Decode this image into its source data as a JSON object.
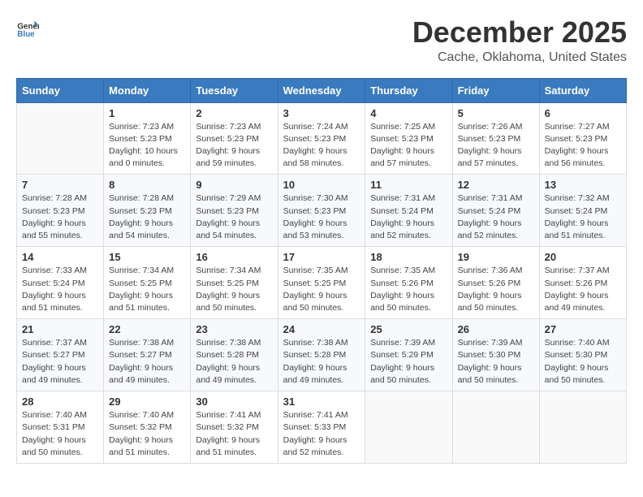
{
  "header": {
    "logo_general": "General",
    "logo_blue": "Blue",
    "title": "December 2025",
    "subtitle": "Cache, Oklahoma, United States"
  },
  "weekdays": [
    "Sunday",
    "Monday",
    "Tuesday",
    "Wednesday",
    "Thursday",
    "Friday",
    "Saturday"
  ],
  "weeks": [
    [
      {
        "day": "",
        "info": ""
      },
      {
        "day": "1",
        "info": "Sunrise: 7:23 AM\nSunset: 5:23 PM\nDaylight: 10 hours\nand 0 minutes."
      },
      {
        "day": "2",
        "info": "Sunrise: 7:23 AM\nSunset: 5:23 PM\nDaylight: 9 hours\nand 59 minutes."
      },
      {
        "day": "3",
        "info": "Sunrise: 7:24 AM\nSunset: 5:23 PM\nDaylight: 9 hours\nand 58 minutes."
      },
      {
        "day": "4",
        "info": "Sunrise: 7:25 AM\nSunset: 5:23 PM\nDaylight: 9 hours\nand 57 minutes."
      },
      {
        "day": "5",
        "info": "Sunrise: 7:26 AM\nSunset: 5:23 PM\nDaylight: 9 hours\nand 57 minutes."
      },
      {
        "day": "6",
        "info": "Sunrise: 7:27 AM\nSunset: 5:23 PM\nDaylight: 9 hours\nand 56 minutes."
      }
    ],
    [
      {
        "day": "7",
        "info": "Sunrise: 7:28 AM\nSunset: 5:23 PM\nDaylight: 9 hours\nand 55 minutes."
      },
      {
        "day": "8",
        "info": "Sunrise: 7:28 AM\nSunset: 5:23 PM\nDaylight: 9 hours\nand 54 minutes."
      },
      {
        "day": "9",
        "info": "Sunrise: 7:29 AM\nSunset: 5:23 PM\nDaylight: 9 hours\nand 54 minutes."
      },
      {
        "day": "10",
        "info": "Sunrise: 7:30 AM\nSunset: 5:23 PM\nDaylight: 9 hours\nand 53 minutes."
      },
      {
        "day": "11",
        "info": "Sunrise: 7:31 AM\nSunset: 5:24 PM\nDaylight: 9 hours\nand 52 minutes."
      },
      {
        "day": "12",
        "info": "Sunrise: 7:31 AM\nSunset: 5:24 PM\nDaylight: 9 hours\nand 52 minutes."
      },
      {
        "day": "13",
        "info": "Sunrise: 7:32 AM\nSunset: 5:24 PM\nDaylight: 9 hours\nand 51 minutes."
      }
    ],
    [
      {
        "day": "14",
        "info": "Sunrise: 7:33 AM\nSunset: 5:24 PM\nDaylight: 9 hours\nand 51 minutes."
      },
      {
        "day": "15",
        "info": "Sunrise: 7:34 AM\nSunset: 5:25 PM\nDaylight: 9 hours\nand 51 minutes."
      },
      {
        "day": "16",
        "info": "Sunrise: 7:34 AM\nSunset: 5:25 PM\nDaylight: 9 hours\nand 50 minutes."
      },
      {
        "day": "17",
        "info": "Sunrise: 7:35 AM\nSunset: 5:25 PM\nDaylight: 9 hours\nand 50 minutes."
      },
      {
        "day": "18",
        "info": "Sunrise: 7:35 AM\nSunset: 5:26 PM\nDaylight: 9 hours\nand 50 minutes."
      },
      {
        "day": "19",
        "info": "Sunrise: 7:36 AM\nSunset: 5:26 PM\nDaylight: 9 hours\nand 50 minutes."
      },
      {
        "day": "20",
        "info": "Sunrise: 7:37 AM\nSunset: 5:26 PM\nDaylight: 9 hours\nand 49 minutes."
      }
    ],
    [
      {
        "day": "21",
        "info": "Sunrise: 7:37 AM\nSunset: 5:27 PM\nDaylight: 9 hours\nand 49 minutes."
      },
      {
        "day": "22",
        "info": "Sunrise: 7:38 AM\nSunset: 5:27 PM\nDaylight: 9 hours\nand 49 minutes."
      },
      {
        "day": "23",
        "info": "Sunrise: 7:38 AM\nSunset: 5:28 PM\nDaylight: 9 hours\nand 49 minutes."
      },
      {
        "day": "24",
        "info": "Sunrise: 7:38 AM\nSunset: 5:28 PM\nDaylight: 9 hours\nand 49 minutes."
      },
      {
        "day": "25",
        "info": "Sunrise: 7:39 AM\nSunset: 5:29 PM\nDaylight: 9 hours\nand 50 minutes."
      },
      {
        "day": "26",
        "info": "Sunrise: 7:39 AM\nSunset: 5:30 PM\nDaylight: 9 hours\nand 50 minutes."
      },
      {
        "day": "27",
        "info": "Sunrise: 7:40 AM\nSunset: 5:30 PM\nDaylight: 9 hours\nand 50 minutes."
      }
    ],
    [
      {
        "day": "28",
        "info": "Sunrise: 7:40 AM\nSunset: 5:31 PM\nDaylight: 9 hours\nand 50 minutes."
      },
      {
        "day": "29",
        "info": "Sunrise: 7:40 AM\nSunset: 5:32 PM\nDaylight: 9 hours\nand 51 minutes."
      },
      {
        "day": "30",
        "info": "Sunrise: 7:41 AM\nSunset: 5:32 PM\nDaylight: 9 hours\nand 51 minutes."
      },
      {
        "day": "31",
        "info": "Sunrise: 7:41 AM\nSunset: 5:33 PM\nDaylight: 9 hours\nand 52 minutes."
      },
      {
        "day": "",
        "info": ""
      },
      {
        "day": "",
        "info": ""
      },
      {
        "day": "",
        "info": ""
      }
    ]
  ]
}
